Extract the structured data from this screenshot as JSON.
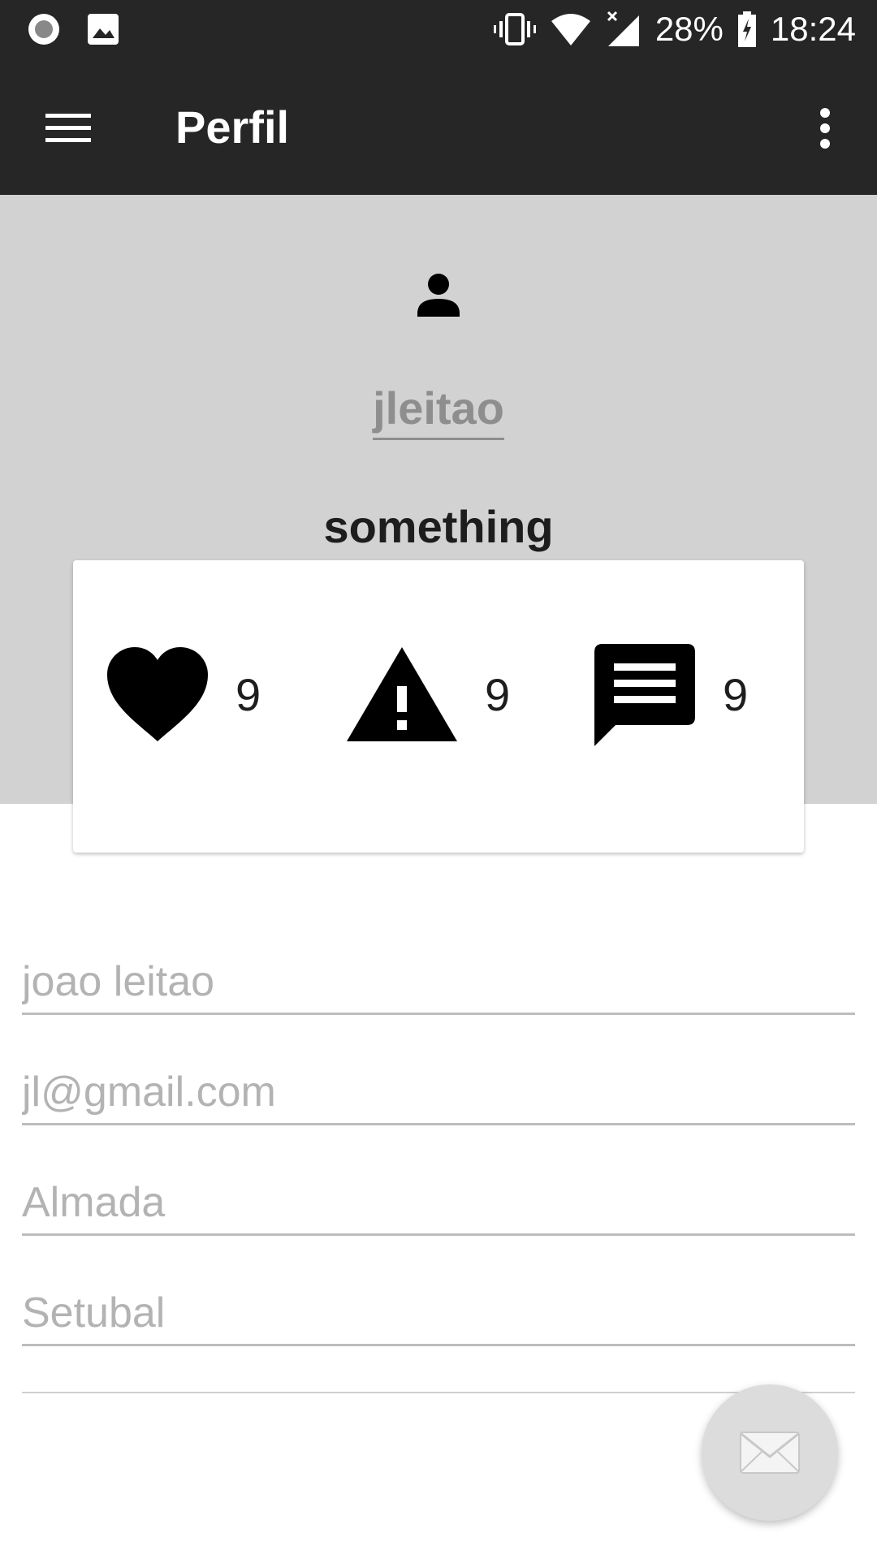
{
  "status_bar": {
    "battery": "28%",
    "time": "18:24",
    "icons": [
      "record-icon",
      "image-icon",
      "vibrate-icon",
      "wifi-icon",
      "signal-icon",
      "battery-charging-icon"
    ]
  },
  "app_bar": {
    "title": "Perfil",
    "menu_icon": "hamburger-menu-icon",
    "overflow_icon": "more-vert-icon"
  },
  "profile": {
    "avatar_icon": "person-icon",
    "username": "jleitao",
    "bio": "something"
  },
  "stats": {
    "likes": "9",
    "reports": "9",
    "comments": "9"
  },
  "form": {
    "name_placeholder": "joao leitao",
    "email_placeholder": "jl@gmail.com",
    "city_placeholder": "Almada",
    "district_placeholder": "Setubal",
    "extra_placeholder": ""
  },
  "fab": {
    "icon": "mail-icon"
  },
  "colors": {
    "bar": "#262626",
    "header_bg": "#d2d2d2",
    "username": "#8e8e8e",
    "hint": "#b3b3b3",
    "fab": "#dcdcdc"
  }
}
